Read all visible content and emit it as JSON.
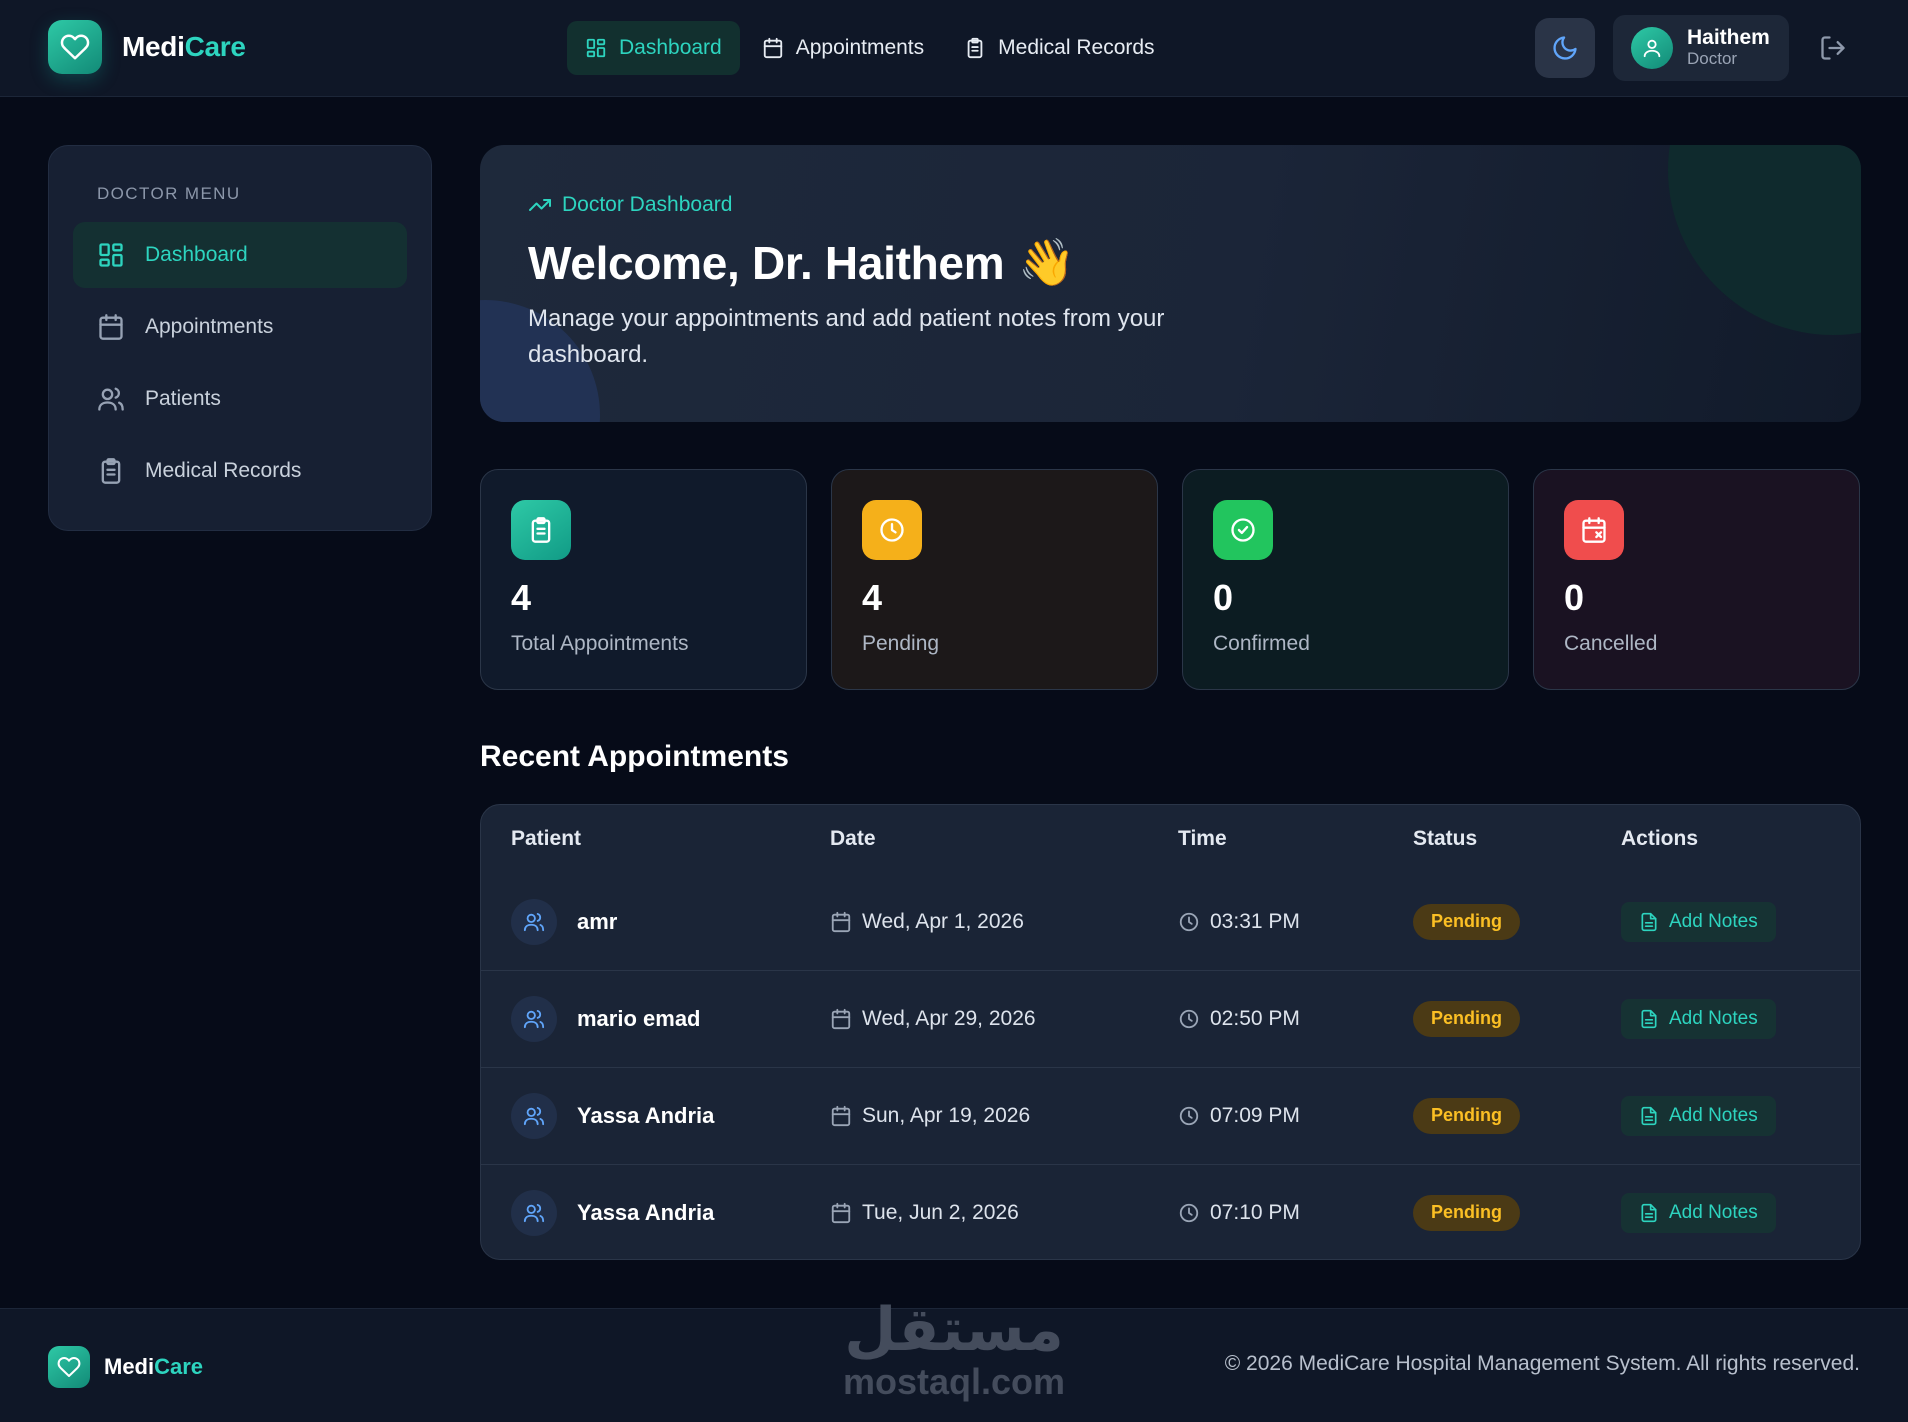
{
  "brand": {
    "part1": "Medi",
    "part2": "Care"
  },
  "nav": {
    "items": [
      {
        "label": "Dashboard",
        "icon": "grid-icon",
        "active": true
      },
      {
        "label": "Appointments",
        "icon": "calendar-icon",
        "active": false
      },
      {
        "label": "Medical Records",
        "icon": "clipboard-icon",
        "active": false
      }
    ]
  },
  "user": {
    "name": "Haithem",
    "role": "Doctor"
  },
  "sidebar": {
    "heading": "DOCTOR MENU",
    "items": [
      {
        "label": "Dashboard",
        "icon": "grid-icon",
        "active": true
      },
      {
        "label": "Appointments",
        "icon": "calendar-icon",
        "active": false
      },
      {
        "label": "Patients",
        "icon": "users-icon",
        "active": false
      },
      {
        "label": "Medical Records",
        "icon": "clipboard-icon",
        "active": false
      }
    ]
  },
  "hero": {
    "tag": "Doctor Dashboard",
    "title": "Welcome, Dr. Haithem",
    "emoji": "👋",
    "subtitle": "Manage your appointments and add patient notes from your dashboard."
  },
  "stats": [
    {
      "value": "4",
      "label": "Total Appointments",
      "icon": "clipboard-icon",
      "color": "#14b8a6"
    },
    {
      "value": "4",
      "label": "Pending",
      "icon": "clock-icon",
      "color": "#f5b01a"
    },
    {
      "value": "0",
      "label": "Confirmed",
      "icon": "check-circle-icon",
      "color": "#22c55e"
    },
    {
      "value": "0",
      "label": "Cancelled",
      "icon": "calendar-x-icon",
      "color": "#f04d4d"
    }
  ],
  "recent": {
    "title": "Recent Appointments",
    "columns": [
      "Patient",
      "Date",
      "Time",
      "Status",
      "Actions"
    ],
    "rows": [
      {
        "patient": "amr",
        "date": "Wed, Apr 1, 2026",
        "time": "03:31 PM",
        "status": "Pending",
        "action": "Add Notes"
      },
      {
        "patient": "mario emad",
        "date": "Wed, Apr 29, 2026",
        "time": "02:50 PM",
        "status": "Pending",
        "action": "Add Notes"
      },
      {
        "patient": "Yassa Andria",
        "date": "Sun, Apr 19, 2026",
        "time": "07:09 PM",
        "status": "Pending",
        "action": "Add Notes"
      },
      {
        "patient": "Yassa Andria",
        "date": "Tue, Jun 2, 2026",
        "time": "07:10 PM",
        "status": "Pending",
        "action": "Add Notes"
      }
    ]
  },
  "footer": {
    "copyright": "© 2026 MediCare Hospital Management System. All rights reserved."
  },
  "watermark": {
    "arabic": "مستقل",
    "latin": "mostaql.com"
  },
  "colors": {
    "accent": "#2dd4bf",
    "pending": "#fbbf24",
    "background": "#060b18",
    "surface": "#172033"
  }
}
